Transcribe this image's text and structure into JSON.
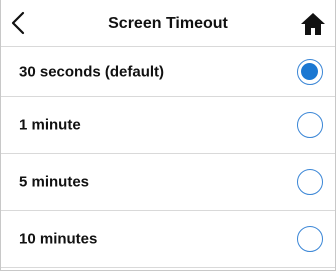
{
  "header": {
    "title": "Screen Timeout",
    "back_icon": "chevron-left-icon",
    "home_icon": "home-icon"
  },
  "options": [
    {
      "label": "30 seconds (default)",
      "selected": true
    },
    {
      "label": "1 minute",
      "selected": false
    },
    {
      "label": "5 minutes",
      "selected": false
    },
    {
      "label": "10 minutes",
      "selected": false
    }
  ],
  "colors": {
    "accent": "#1a77d2",
    "divider": "#d9d9d9"
  }
}
